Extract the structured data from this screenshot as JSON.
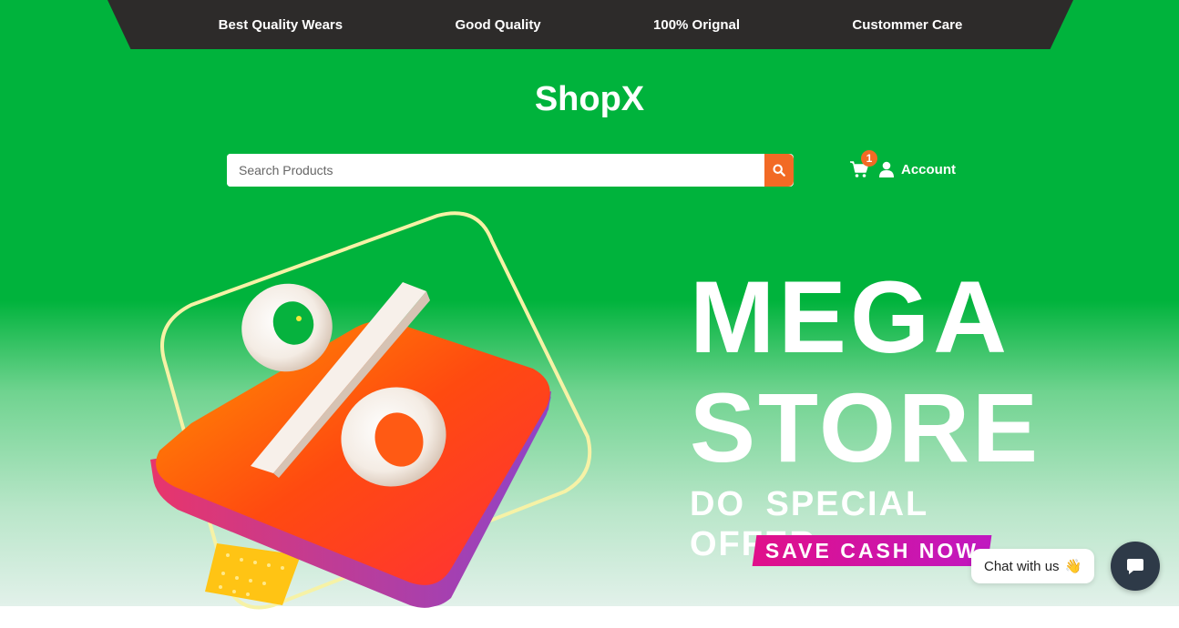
{
  "topbar": {
    "items": [
      "Best Quality Wears",
      "Good Quality",
      "100% Orignal",
      "Custommer Care"
    ]
  },
  "brand": {
    "name": "ShopX"
  },
  "search": {
    "placeholder": "Search Products",
    "value": "",
    "button_icon": "search-icon"
  },
  "cart": {
    "icon": "cart-icon",
    "count": "1"
  },
  "account": {
    "icon": "user-icon",
    "label": "Account"
  },
  "banner": {
    "line1": "MEGA",
    "line2": "STORE",
    "line3": "DO SPECIAL  OFFER",
    "cta": "SAVE CASH NOW",
    "art_symbol": "%"
  },
  "chat": {
    "bubble_label": "Chat with us",
    "emoji": "👋",
    "button_icon": "chat-icon"
  },
  "colors": {
    "brand_green": "#00b33c",
    "accent_orange": "#f26a25",
    "topbar_dark": "#2d2b2a",
    "cta_magenta": "#e0108a",
    "chat_dark": "#2e3a48"
  }
}
